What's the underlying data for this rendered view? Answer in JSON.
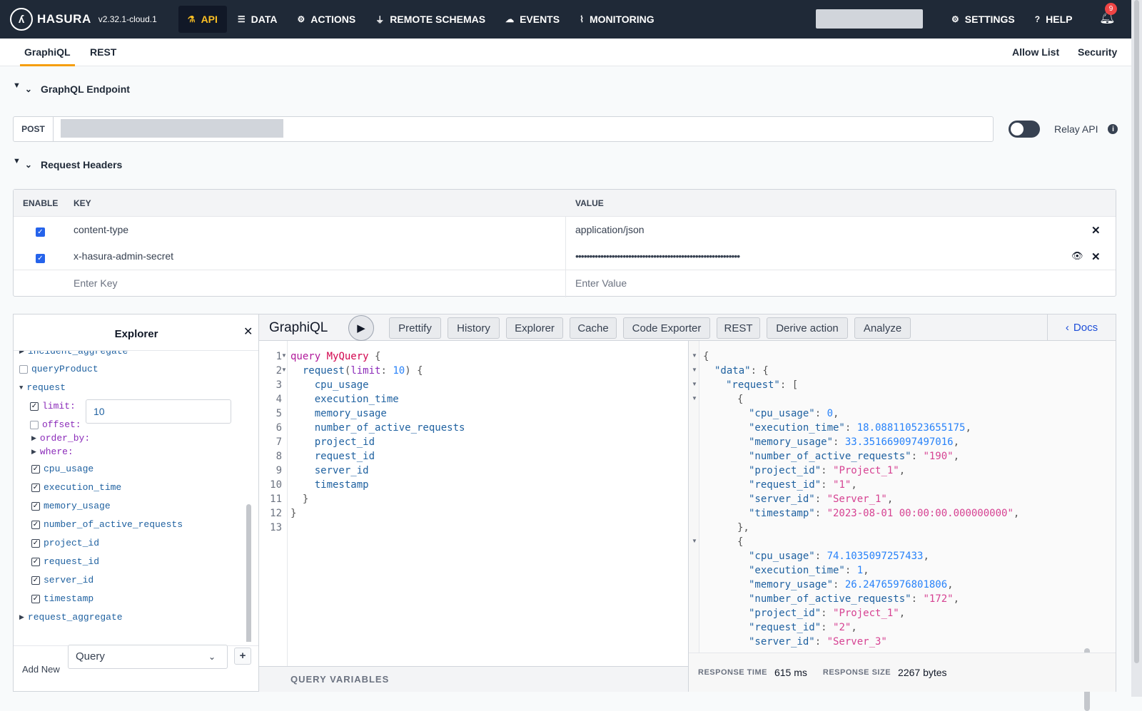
{
  "app": {
    "brand": "HASURA",
    "version": "v2.32.1-cloud.1",
    "notifications": "9"
  },
  "nav": {
    "api": "API",
    "data": "DATA",
    "actions": "ACTIONS",
    "remote_schemas": "REMOTE SCHEMAS",
    "events": "EVENTS",
    "monitoring": "MONITORING",
    "settings": "SETTINGS",
    "help": "HELP"
  },
  "subtabs": {
    "graphiql": "GraphiQL",
    "rest": "REST",
    "allow_list": "Allow List",
    "security": "Security"
  },
  "endpoint": {
    "section": "GraphQL Endpoint",
    "method": "POST",
    "relay_label": "Relay API"
  },
  "headers": {
    "section": "Request Headers",
    "col_enable": "ENABLE",
    "col_key": "KEY",
    "col_value": "VALUE",
    "rows": [
      {
        "key": "content-type",
        "value": "application/json"
      },
      {
        "key": "x-hasura-admin-secret",
        "value": "•••••••••••••••••••••••••••••••••••••••••••••••••••••••••••"
      }
    ],
    "key_placeholder": "Enter Key",
    "value_placeholder": "Enter Value"
  },
  "explorer": {
    "title": "Explorer",
    "items": {
      "incident_aggregate": "incident_aggregate",
      "queryProduct": "queryProduct",
      "request": "request",
      "limit": "limit:",
      "limit_value": "10",
      "offset": "offset:",
      "order_by": "order_by:",
      "where": "where:",
      "cpu_usage": "cpu_usage",
      "execution_time": "execution_time",
      "memory_usage": "memory_usage",
      "number_of_active_requests": "number_of_active_requests",
      "project_id": "project_id",
      "request_id": "request_id",
      "server_id": "server_id",
      "timestamp": "timestamp",
      "request_aggregate": "request_aggregate"
    },
    "add_new_label": "Add New",
    "add_new_selected": "Query",
    "plus": "+"
  },
  "graphiql": {
    "title": "GraphiQL",
    "buttons": {
      "prettify": "Prettify",
      "history": "History",
      "explorer": "Explorer",
      "cache": "Cache",
      "code_exporter": "Code Exporter",
      "rest": "REST",
      "derive_action": "Derive action",
      "analyze": "Analyze"
    },
    "docs": "Docs",
    "query_variables": "QUERY VARIABLES",
    "editor": {
      "line_numbers": [
        "1",
        "2",
        "3",
        "4",
        "5",
        "6",
        "7",
        "8",
        "9",
        "10",
        "11",
        "12",
        "13"
      ],
      "kw_query": "query",
      "op_name": "MyQuery",
      "brace_open": "{",
      "root_field": "request",
      "arg_open": "(",
      "arg_name": "limit",
      "colon": ":",
      "arg_value": "10",
      "arg_close": ")",
      "fields": [
        "cpu_usage",
        "execution_time",
        "memory_usage",
        "number_of_active_requests",
        "project_id",
        "request_id",
        "server_id",
        "timestamp"
      ],
      "brace_close": "}"
    },
    "result": {
      "key_data": "\"data\"",
      "key_request": "\"request\"",
      "records": [
        {
          "cpu_usage": "0",
          "execution_time": "18.088110523655175",
          "memory_usage": "33.351669097497016",
          "number_of_active_requests": "\"190\"",
          "project_id": "\"Project_1\"",
          "request_id": "\"1\"",
          "server_id": "\"Server_1\"",
          "timestamp": "\"2023-08-01 00:00:00.000000000\""
        },
        {
          "cpu_usage": "74.1035097257433",
          "execution_time": "1",
          "memory_usage": "26.24765976801806",
          "number_of_active_requests": "\"172\"",
          "project_id": "\"Project_1\"",
          "request_id": "\"2\"",
          "server_id": "\"Server_3\""
        }
      ],
      "response_time_label": "RESPONSE TIME",
      "response_time": "615 ms",
      "response_size_label": "RESPONSE SIZE",
      "response_size": "2267 bytes"
    }
  },
  "colors": {
    "topbar": "#1f2937",
    "accent": "#fbbf24",
    "checkbox": "#2563eb"
  }
}
